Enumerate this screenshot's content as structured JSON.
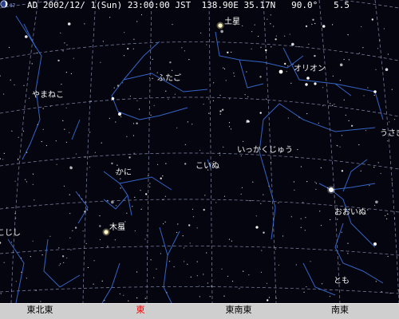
{
  "header": {
    "moon_age": "07",
    "datetime": "AD 2002/12/ 1(Sun) 23:00:00 JST",
    "location": "138.90E 35.17N",
    "field": "90.0°",
    "limit_magnitude": "5.5"
  },
  "constellations": [
    "やまねこ",
    "ふたご",
    "オリオン",
    "うさぎ",
    "いっかくじゅう",
    "こいぬ",
    "かに",
    "おおいぬ",
    "こじし",
    "とも"
  ],
  "planets": [
    "土星",
    "木星"
  ],
  "directions": [
    "東北東",
    "東",
    "東南東",
    "南東"
  ],
  "colors": {
    "sky": "#05050f",
    "constellation_line": "#3a6fd8",
    "grid": "#9aa3c8",
    "stars": "#ffffff",
    "horizon": "#cfcfcf",
    "highlight_direction": "#ff0000"
  },
  "icons": {
    "moon_phase": "moon-phase-icon",
    "planet": "planet-star-icon"
  }
}
